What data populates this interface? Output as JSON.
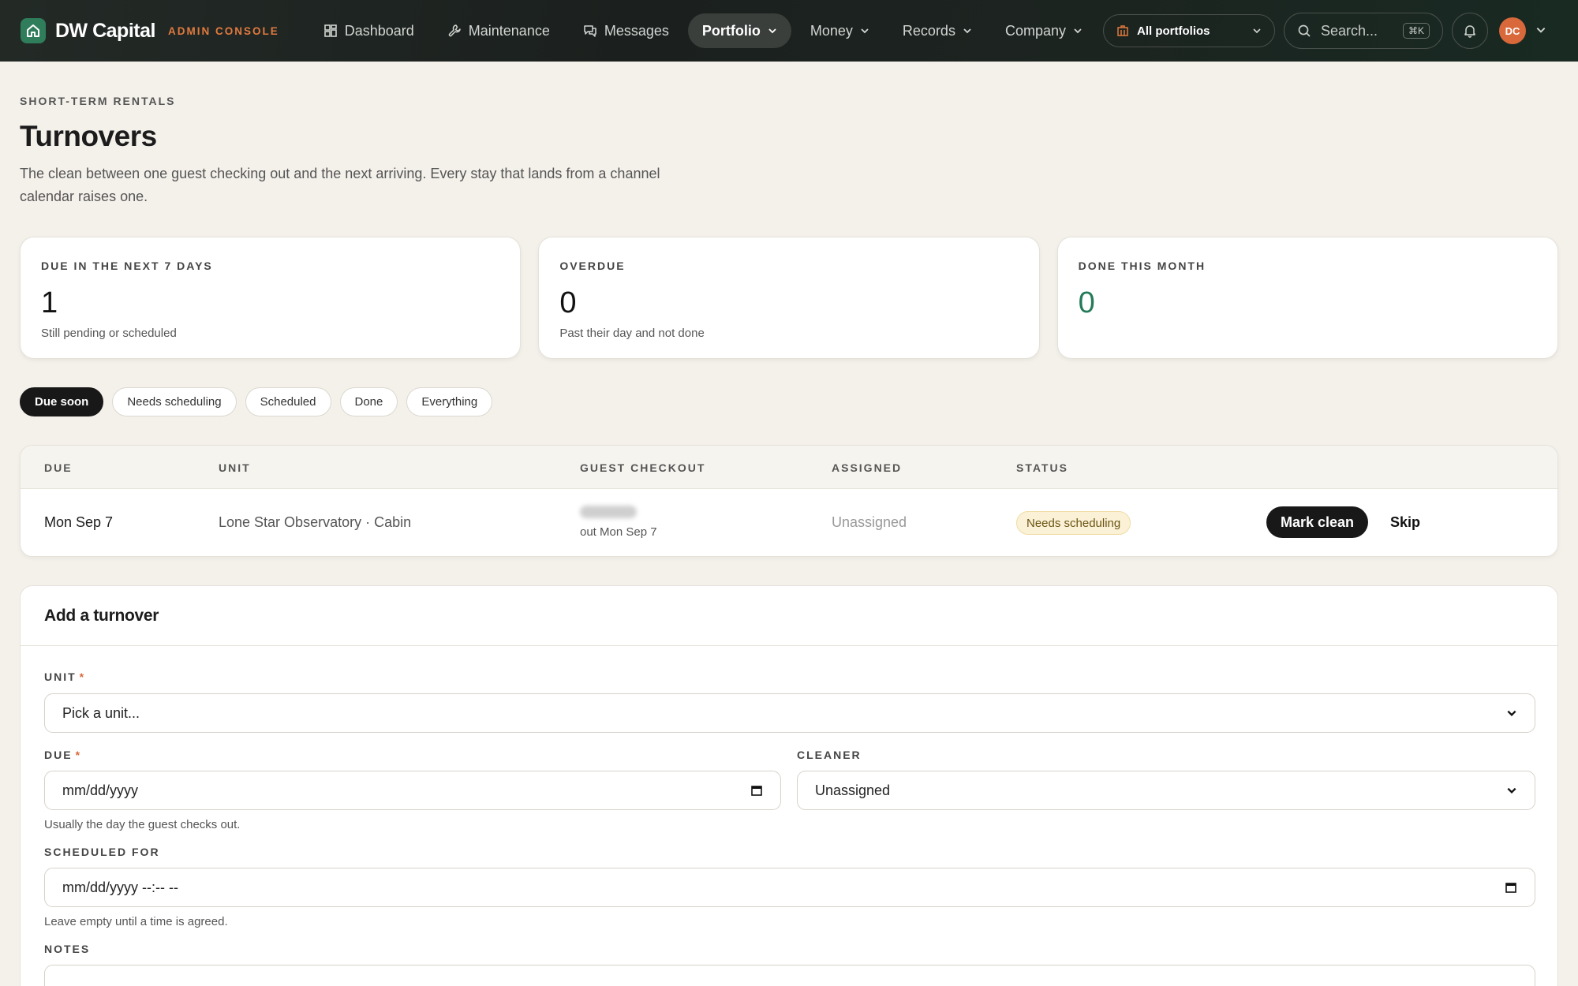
{
  "brand": {
    "name": "DW Capital",
    "subtitle": "ADMIN CONSOLE"
  },
  "nav": [
    {
      "label": "Dashboard",
      "icon": "grid-icon",
      "active": false,
      "dropdown": false
    },
    {
      "label": "Maintenance",
      "icon": "wrench-icon",
      "active": false,
      "dropdown": false
    },
    {
      "label": "Messages",
      "icon": "chat-icon",
      "active": false,
      "dropdown": false
    },
    {
      "label": "Portfolio",
      "icon": "",
      "active": true,
      "dropdown": true
    },
    {
      "label": "Money",
      "icon": "",
      "active": false,
      "dropdown": true
    },
    {
      "label": "Records",
      "icon": "",
      "active": false,
      "dropdown": true
    },
    {
      "label": "Company",
      "icon": "",
      "active": false,
      "dropdown": true
    }
  ],
  "header": {
    "portfolio_filter": "All portfolios",
    "search_placeholder": "Search...",
    "search_shortcut": "⌘K",
    "avatar_initials": "DC"
  },
  "page": {
    "eyebrow": "SHORT-TERM RENTALS",
    "title": "Turnovers",
    "description": "The clean between one guest checking out and the next arriving. Every stay that lands from a channel calendar raises one."
  },
  "stats": [
    {
      "label": "DUE IN THE NEXT 7 DAYS",
      "value": "1",
      "note": "Still pending or scheduled",
      "accent": "#111111"
    },
    {
      "label": "OVERDUE",
      "value": "0",
      "note": "Past their day and not done",
      "accent": "#111111"
    },
    {
      "label": "DONE THIS MONTH",
      "value": "0",
      "note": "",
      "accent": "#257a5a"
    }
  ],
  "filters": [
    {
      "label": "Due soon",
      "active": true
    },
    {
      "label": "Needs scheduling",
      "active": false
    },
    {
      "label": "Scheduled",
      "active": false
    },
    {
      "label": "Done",
      "active": false
    },
    {
      "label": "Everything",
      "active": false
    }
  ],
  "table": {
    "headers": {
      "due": "DUE",
      "unit": "UNIT",
      "checkout": "GUEST CHECKOUT",
      "assigned": "ASSIGNED",
      "status": "STATUS"
    },
    "rows": [
      {
        "due": "Mon Sep 7",
        "unit": "Lone Star Observatory · Cabin",
        "checkout_note": "out Mon Sep 7",
        "assigned": "Unassigned",
        "status": "Needs scheduling",
        "primary_action": "Mark clean",
        "secondary_action": "Skip"
      }
    ]
  },
  "form": {
    "title": "Add a turnover",
    "unit_label": "UNIT",
    "unit_value": "Pick a unit...",
    "due_label": "DUE",
    "due_value": "mm/dd/yyyy",
    "due_hint": "Usually the day the guest checks out.",
    "cleaner_label": "CLEANER",
    "cleaner_value": "Unassigned",
    "scheduled_label": "SCHEDULED FOR",
    "scheduled_value": "mm/dd/yyyy --:-- --",
    "scheduled_hint": "Leave empty until a time is agreed.",
    "notes_label": "NOTES",
    "required_mark": "*"
  }
}
